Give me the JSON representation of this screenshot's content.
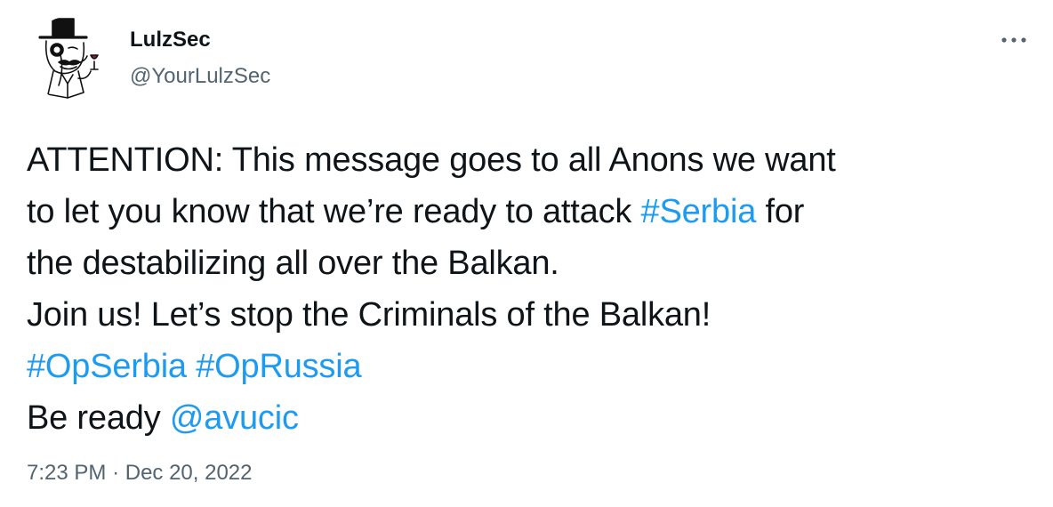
{
  "author": {
    "name": "LulzSec",
    "handle": "@YourLulzSec",
    "avatar_icon": "lulzsec-monocle-man-icon"
  },
  "tweet": {
    "line1": "ATTENTION: This message goes to all Anons we want",
    "line2_prefix": "to let you know that we’re ready to attack ",
    "line2_hashtag": "#Serbia",
    "line2_suffix": " for",
    "line3": "the destabilizing all over the Balkan.",
    "line4": "Join us! Let’s stop the Criminals of the Balkan!",
    "hashtag_opserbia": "#OpSerbia",
    "hashtag_oprussia": "#OpRussia",
    "line6_prefix": "Be ready ",
    "mention": "@avucic"
  },
  "meta": {
    "time": "7:23 PM",
    "separator": "·",
    "date": "Dec 20, 2022"
  },
  "colors": {
    "link": "#1d9bf0",
    "text": "#0f1419",
    "secondary": "#536471"
  }
}
